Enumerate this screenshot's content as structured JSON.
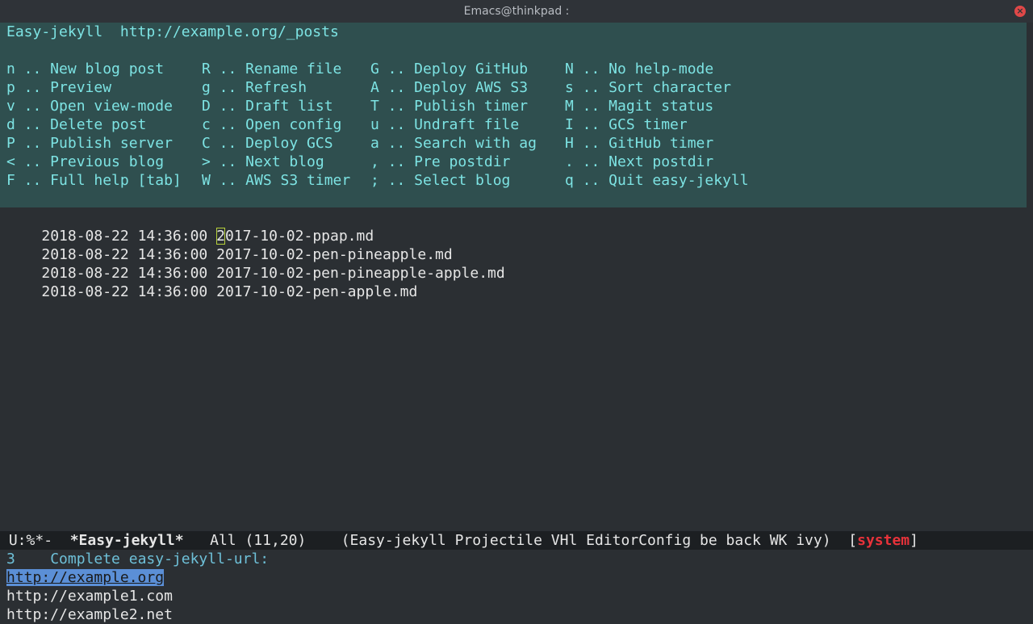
{
  "window": {
    "title": "Emacs@thinkpad :",
    "close_glyph": "×"
  },
  "header": {
    "title_line": "Easy-jekyll  http://example.org/_posts",
    "help_rows": [
      [
        "n .. New blog post",
        "R .. Rename file",
        "G .. Deploy GitHub",
        "N .. No help-mode"
      ],
      [
        "p .. Preview",
        "g .. Refresh",
        "A .. Deploy AWS S3",
        "s .. Sort character"
      ],
      [
        "v .. Open view-mode",
        "D .. Draft list",
        "T .. Publish timer",
        "M .. Magit status"
      ],
      [
        "d .. Delete post",
        "c .. Open config",
        "u .. Undraft file",
        "I .. GCS timer"
      ],
      [
        "P .. Publish server",
        "C .. Deploy GCS",
        "a .. Search with ag",
        "H .. GitHub timer"
      ],
      [
        "< .. Previous blog",
        "> .. Next blog",
        ", .. Pre postdir",
        ". .. Next postdir"
      ],
      [
        "F .. Full help [tab]",
        "W .. AWS S3 timer",
        "; .. Select blog",
        "q .. Quit easy-jekyll"
      ]
    ]
  },
  "posts": [
    {
      "date": "2018-08-22 14:36:00",
      "file": "2017-10-02-ppap.md"
    },
    {
      "date": "2018-08-22 14:36:00",
      "file": "2017-10-02-pen-pineapple.md"
    },
    {
      "date": "2018-08-22 14:36:00",
      "file": "2017-10-02-pen-pineapple-apple.md"
    },
    {
      "date": "2018-08-22 14:36:00",
      "file": "2017-10-02-pen-apple.md"
    }
  ],
  "modeline": {
    "status": "U:%*-",
    "buffer": "*Easy-jekyll*",
    "position": "All (11,20)",
    "modes": "(Easy-jekyll Projectile VHl EditorConfig be back WK ivy)",
    "bracket_open": "[",
    "system": "system",
    "bracket_close": "]"
  },
  "minibuffer": {
    "count": "3",
    "prompt": "Complete easy-jekyll-url:",
    "candidates": [
      "http://example.org",
      "http://example1.com",
      "http://example2.net"
    ],
    "selected_index": 0
  },
  "colors": {
    "header_bg": "#2f4f4f",
    "header_text": "#7de3e3",
    "selection": "#5b8fd6",
    "system_red": "#e8323a"
  }
}
